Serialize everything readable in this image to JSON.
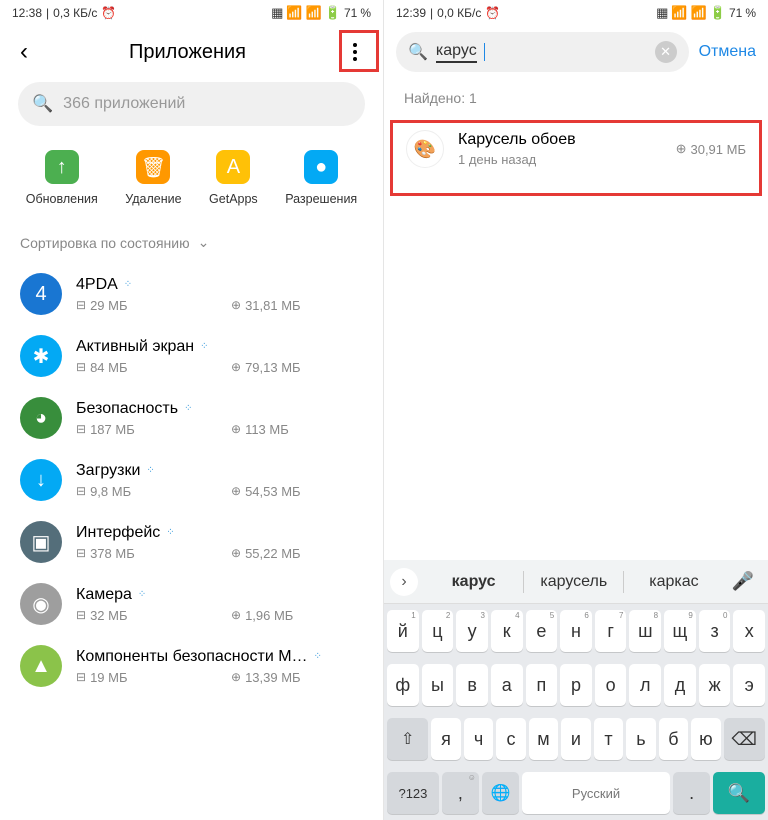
{
  "left": {
    "status": {
      "time": "12:38",
      "speed": "0,3 КБ/с",
      "battery": "71"
    },
    "header_title": "Приложения",
    "search_placeholder": "366 приложений",
    "quick_actions": [
      {
        "label": "Обновления",
        "color": "#4caf50",
        "glyph": "↑"
      },
      {
        "label": "Удаление",
        "color": "#ff9800",
        "glyph": "🗑"
      },
      {
        "label": "GetApps",
        "color": "#ffc107",
        "glyph": "A"
      },
      {
        "label": "Разрешения",
        "color": "#03a9f4",
        "glyph": "●"
      }
    ],
    "sort_label": "Сортировка по состоянию",
    "apps": [
      {
        "name": "4PDA",
        "ram": "29 МБ",
        "storage": "31,81 МБ",
        "icon_bg": "#1976d2",
        "glyph": "4"
      },
      {
        "name": "Активный экран",
        "ram": "84 МБ",
        "storage": "79,13 МБ",
        "icon_bg": "#03a9f4",
        "glyph": "✱"
      },
      {
        "name": "Безопасность",
        "ram": "187 МБ",
        "storage": "113 МБ",
        "icon_bg": "#388e3c",
        "glyph": "◕"
      },
      {
        "name": "Загрузки",
        "ram": "9,8 МБ",
        "storage": "54,53 МБ",
        "icon_bg": "#03a9f4",
        "glyph": "↓"
      },
      {
        "name": "Интерфейс",
        "ram": "378 МБ",
        "storage": "55,22 МБ",
        "icon_bg": "#546e7a",
        "glyph": "▣"
      },
      {
        "name": "Камера",
        "ram": "32 МБ",
        "storage": "1,96 МБ",
        "icon_bg": "#9e9e9e",
        "glyph": "◉"
      },
      {
        "name": "Компоненты безопасности M…",
        "ram": "19 МБ",
        "storage": "13,39 МБ",
        "icon_bg": "#8bc34a",
        "glyph": "▲"
      }
    ]
  },
  "right": {
    "status": {
      "time": "12:39",
      "speed": "0,0 КБ/с",
      "battery": "71"
    },
    "search_value": "карус",
    "cancel_label": "Отмена",
    "found_label": "Найдено: 1",
    "result": {
      "name": "Карусель обоев",
      "sub": "1 день назад",
      "size": "30,91 МБ"
    },
    "keyboard": {
      "suggestions": [
        "карус",
        "карусель",
        "каркас"
      ],
      "row1": [
        {
          "k": "й",
          "s": "1"
        },
        {
          "k": "ц",
          "s": "2"
        },
        {
          "k": "у",
          "s": "3"
        },
        {
          "k": "к",
          "s": "4"
        },
        {
          "k": "е",
          "s": "5"
        },
        {
          "k": "н",
          "s": "6"
        },
        {
          "k": "г",
          "s": "7"
        },
        {
          "k": "ш",
          "s": "8"
        },
        {
          "k": "щ",
          "s": "9"
        },
        {
          "k": "з",
          "s": "0"
        },
        {
          "k": "х",
          "s": ""
        }
      ],
      "row2": [
        {
          "k": "ф"
        },
        {
          "k": "ы"
        },
        {
          "k": "в"
        },
        {
          "k": "а"
        },
        {
          "k": "п"
        },
        {
          "k": "р"
        },
        {
          "k": "о"
        },
        {
          "k": "л"
        },
        {
          "k": "д"
        },
        {
          "k": "ж"
        },
        {
          "k": "э"
        }
      ],
      "row3": [
        {
          "k": "я"
        },
        {
          "k": "ч"
        },
        {
          "k": "с"
        },
        {
          "k": "м"
        },
        {
          "k": "и"
        },
        {
          "k": "т"
        },
        {
          "k": "ь"
        },
        {
          "k": "б"
        },
        {
          "k": "ю"
        }
      ],
      "num_label": "?123",
      "space_label": "Русский"
    }
  }
}
